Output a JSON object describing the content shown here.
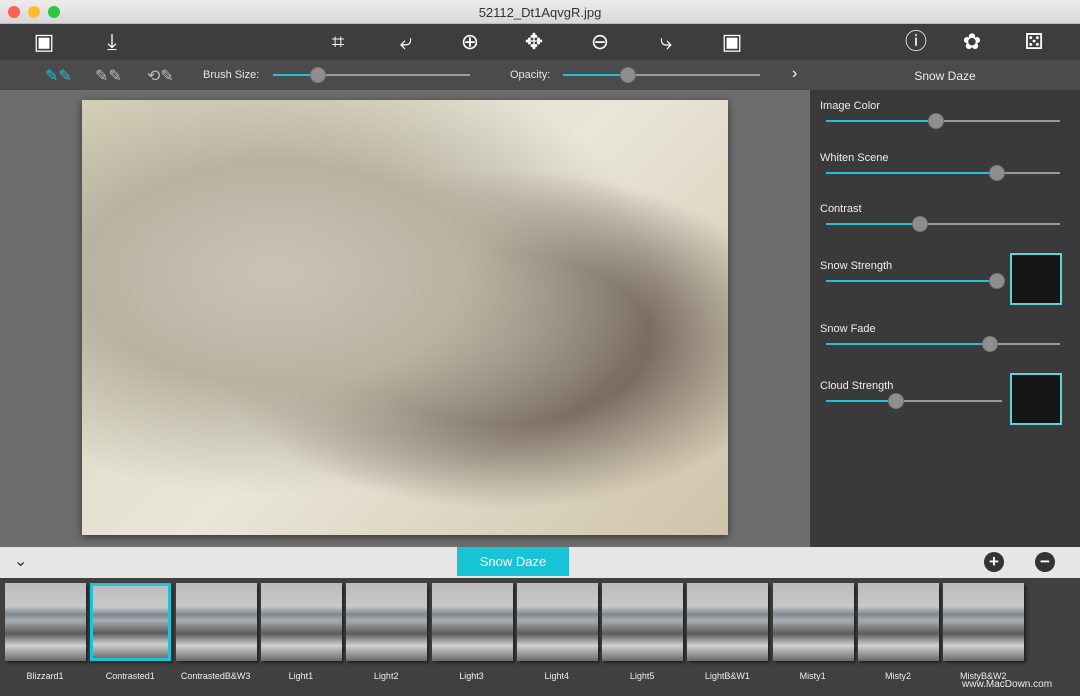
{
  "window": {
    "title": "52112_Dt1AqvgR.jpg"
  },
  "toolbar": {
    "left": [
      {
        "icon": "open-image-icon",
        "glyph": "▣"
      },
      {
        "icon": "save-icon",
        "glyph": "⤓"
      }
    ],
    "center": [
      {
        "icon": "crop-icon",
        "glyph": "⌗"
      },
      {
        "icon": "undo-icon",
        "glyph": "⤶"
      },
      {
        "icon": "zoom-in-icon",
        "glyph": "⊕"
      },
      {
        "icon": "move-icon",
        "glyph": "✥"
      },
      {
        "icon": "zoom-out-icon",
        "glyph": "⊖"
      },
      {
        "icon": "redo-icon",
        "glyph": "⤷"
      },
      {
        "icon": "fit-image-icon",
        "glyph": "▣"
      }
    ],
    "right": [
      {
        "icon": "info-icon",
        "glyph": "ⓘ"
      },
      {
        "icon": "settings-icon",
        "glyph": "✿"
      },
      {
        "icon": "random-dice-icon",
        "glyph": "⚄"
      }
    ]
  },
  "brushbar": {
    "brush_size_label": "Brush Size:",
    "brush_size": 0.23,
    "opacity_label": "Opacity:",
    "opacity": 0.33,
    "accent": "#1cc4d6"
  },
  "panel": {
    "title": "Snow Daze",
    "sliders": [
      {
        "label": "Image Color",
        "value": 0.47
      },
      {
        "label": "Whiten Scene",
        "value": 0.73
      },
      {
        "label": "Contrast",
        "value": 0.4
      },
      {
        "label": "Snow Strength",
        "value": 0.97,
        "swatch": true
      },
      {
        "label": "Snow Fade",
        "value": 0.7
      },
      {
        "label": "Cloud Strength",
        "value": 0.4,
        "swatch": true
      }
    ]
  },
  "presets": {
    "category": "Snow Daze",
    "items": [
      "Blizzard1",
      "Contrasted1",
      "ContrastedB&W3",
      "Light1",
      "Light2",
      "Light3",
      "Light4",
      "Light5",
      "LightB&W1",
      "Misty1",
      "Misty2",
      "MistyB&W2"
    ],
    "selected": 1
  },
  "watermark": "www.MacDown.com"
}
